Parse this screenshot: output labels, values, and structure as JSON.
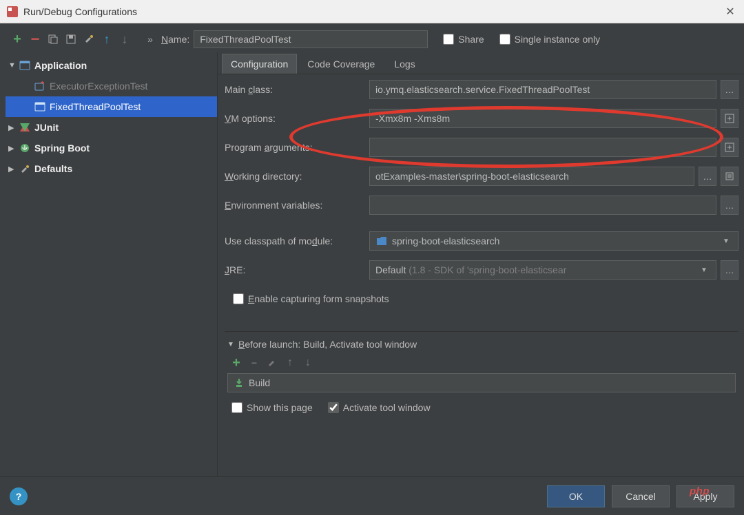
{
  "window": {
    "title": "Run/Debug Configurations"
  },
  "toolbar": {
    "name_label": "Name:",
    "name_value": "FixedThreadPoolTest",
    "share_label": "Share",
    "single_instance_label": "Single instance only"
  },
  "tree": {
    "nodes": [
      {
        "label": "Application",
        "bold": true
      },
      {
        "label": "ExecutorExceptionTest"
      },
      {
        "label": "FixedThreadPoolTest"
      },
      {
        "label": "JUnit",
        "bold": true
      },
      {
        "label": "Spring Boot",
        "bold": true
      },
      {
        "label": "Defaults",
        "bold": true
      }
    ]
  },
  "tabs": {
    "items": [
      "Configuration",
      "Code Coverage",
      "Logs"
    ]
  },
  "form": {
    "main_class_label": "Main class:",
    "main_class_value": "io.ymq.elasticsearch.service.FixedThreadPoolTest",
    "vm_options_label": "VM options:",
    "vm_options_value": "-Xmx8m -Xms8m",
    "program_args_label": "Program arguments:",
    "program_args_value": "",
    "working_dir_label": "Working directory:",
    "working_dir_value": "otExamples-master\\spring-boot-elasticsearch",
    "env_vars_label": "Environment variables:",
    "env_vars_value": "",
    "classpath_label": "Use classpath of module:",
    "classpath_value": "spring-boot-elasticsearch",
    "jre_label": "JRE:",
    "jre_value_prefix": "Default ",
    "jre_value_suffix": "(1.8 - SDK of 'spring-boot-elasticsear",
    "enable_snapshots_label": "Enable capturing form snapshots"
  },
  "before_launch": {
    "header": "Before launch: Build, Activate tool window",
    "item": "Build",
    "show_this_page_label": "Show this page",
    "activate_tool_window_label": "Activate tool window"
  },
  "footer": {
    "ok": "OK",
    "cancel": "Cancel",
    "apply": "Apply"
  },
  "watermark": "php"
}
